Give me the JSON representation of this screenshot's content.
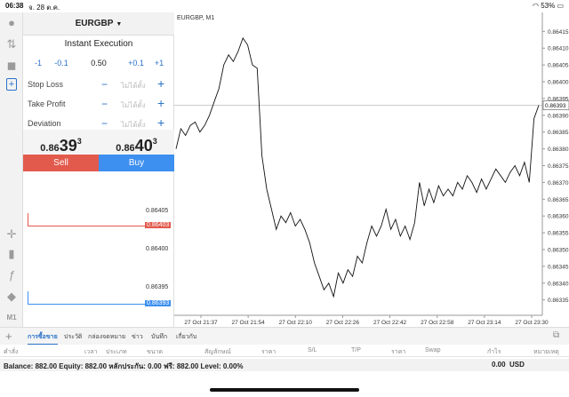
{
  "status": {
    "time": "06:38",
    "date": "จ. 28 ต.ค.",
    "battery": "53%"
  },
  "order": {
    "symbol": "EURGBP",
    "execution": "Instant Execution",
    "steps": [
      "-1",
      "-0.1",
      "+0.1",
      "+1"
    ],
    "volume": "0.50",
    "rows": [
      {
        "label": "Stop Loss",
        "value": "ไม่ได้ตั้ง"
      },
      {
        "label": "Take Profit",
        "value": "ไม่ได้ตั้ง"
      },
      {
        "label": "Deviation",
        "value": "ไม่ได้ตั้ง"
      }
    ],
    "sell_price": {
      "small": "0.86",
      "big": "39",
      "sup": "3"
    },
    "buy_price": {
      "small": "0.86",
      "big": "40",
      "sup": "3"
    },
    "sell_label": "Sell",
    "buy_label": "Buy",
    "levels": [
      {
        "label": "0.86405"
      },
      {
        "label": "0.86403",
        "kind": "ask"
      },
      {
        "label": "0.86400"
      },
      {
        "label": "0.86395"
      },
      {
        "label": "0.86393",
        "kind": "bid"
      }
    ]
  },
  "chart": {
    "title": "EURGBP, M1",
    "current_price": "0.86393",
    "yticks": [
      "0.86415",
      "0.86410",
      "0.86405",
      "0.86400",
      "0.86395",
      "0.86390",
      "0.86385",
      "0.86380",
      "0.86375",
      "0.86370",
      "0.86365",
      "0.86360",
      "0.86355",
      "0.86350",
      "0.86345",
      "0.86340",
      "0.86335"
    ],
    "xticks": [
      "27 Oct 21:37",
      "27 Oct 21:54",
      "27 Oct 22:10",
      "27 Oct 22:26",
      "27 Oct 22:42",
      "27 Oct 22:58",
      "27 Oct 23:14",
      "27 Oct 23:30"
    ],
    "accent": "#3d8ff0",
    "sell_color": "#e25a4c"
  },
  "chart_data": {
    "type": "line",
    "title": "EURGBP, M1",
    "ylim": [
      0.86332,
      0.86418
    ],
    "series": [
      {
        "values": [
          0.8638,
          0.86386,
          0.86384,
          0.86387,
          0.86388,
          0.86385,
          0.86387,
          0.8639,
          0.86394,
          0.86398,
          0.86405,
          0.86408,
          0.86406,
          0.86409,
          0.86413,
          0.86411,
          0.86405,
          0.86404,
          0.86378,
          0.86368,
          0.86362,
          0.86356,
          0.8636,
          0.86358,
          0.86361,
          0.86357,
          0.86359,
          0.86356,
          0.86352,
          0.86346,
          0.86342,
          0.86338,
          0.8634,
          0.86336,
          0.86343,
          0.8634,
          0.86344,
          0.86342,
          0.86348,
          0.86346,
          0.86352,
          0.86357,
          0.86354,
          0.86357,
          0.86362,
          0.86356,
          0.86359,
          0.86354,
          0.86357,
          0.86353,
          0.86358,
          0.8637,
          0.86363,
          0.86368,
          0.86364,
          0.86369,
          0.86366,
          0.86368,
          0.86366,
          0.8637,
          0.86368,
          0.86372,
          0.8637,
          0.86367,
          0.86371,
          0.86368,
          0.86371,
          0.86374,
          0.86372,
          0.8637,
          0.86373,
          0.86375,
          0.86372,
          0.86376,
          0.8637,
          0.86389,
          0.86393
        ]
      }
    ],
    "grid": false,
    "current_price": 0.86393
  },
  "tabs": [
    "การซื้อขาย",
    "ประวัติ",
    "กล่องจดหมาย",
    "ข่าว",
    "บันทึก",
    "เกี่ยวกับ"
  ],
  "columns": [
    "คำสั่ง",
    "เวลา",
    "ประเภท",
    "ขนาด",
    "สัญลักษณ์",
    "ราคา",
    "S/L",
    "T/P",
    "ราคา",
    "Swap",
    "กำไร",
    "หมายเหตุ"
  ],
  "balance": {
    "text": "Balance: 882.00 Equity: 882.00 หลักประกัน: 0.00 ฟรี: 882.00 Level: 0.00%",
    "profit": "0.00",
    "currency": "USD"
  }
}
